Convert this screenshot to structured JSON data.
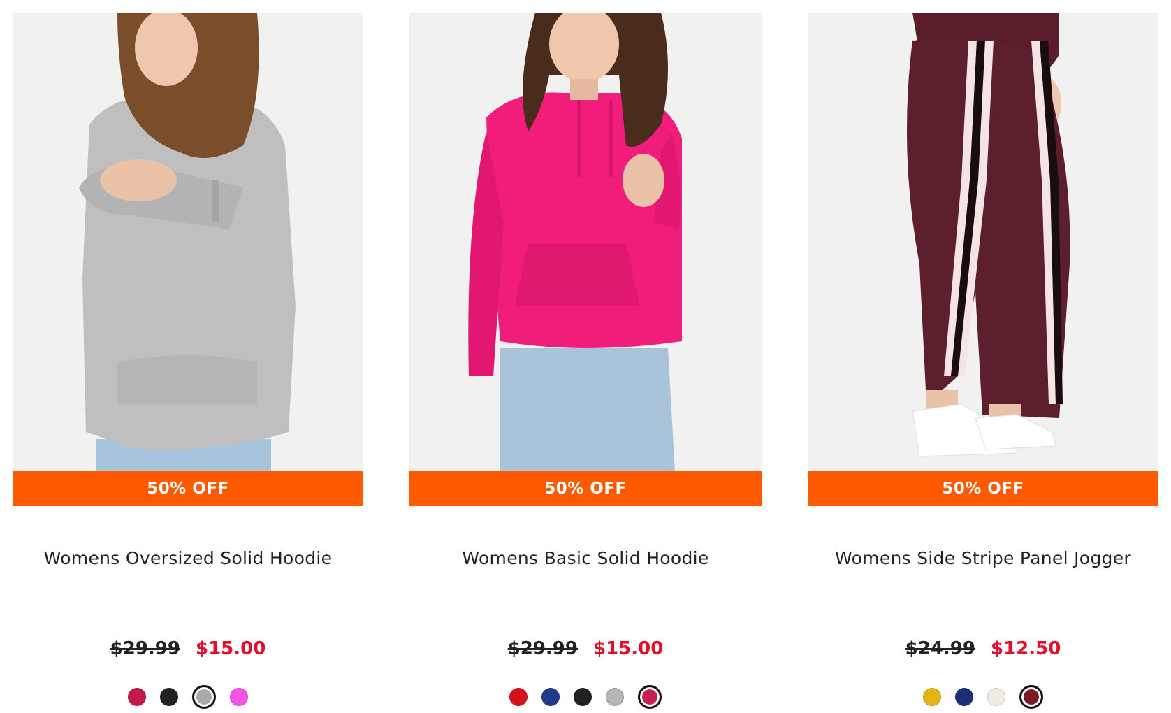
{
  "products": [
    {
      "title": "Womens Oversized Solid Hoodie",
      "badge": "50% OFF",
      "original_price": "$29.99",
      "sale_price": "$15.00",
      "swatches": [
        {
          "name": "berry",
          "color": "#c21a4a",
          "selected": false
        },
        {
          "name": "black",
          "color": "#222222",
          "selected": false
        },
        {
          "name": "heather-grey",
          "color": "#a8a9ab",
          "selected": true
        },
        {
          "name": "pink",
          "color": "#f553e8",
          "selected": false
        }
      ]
    },
    {
      "title": "Womens Basic Solid Hoodie",
      "badge": "50% OFF",
      "original_price": "$29.99",
      "sale_price": "$15.00",
      "swatches": [
        {
          "name": "red",
          "color": "#d8101c",
          "selected": false
        },
        {
          "name": "navy",
          "color": "#223a8c",
          "selected": false
        },
        {
          "name": "black",
          "color": "#222222",
          "selected": false
        },
        {
          "name": "grey",
          "color": "#b5b6b8",
          "selected": false
        },
        {
          "name": "fuchsia",
          "color": "#c8204e",
          "selected": true
        }
      ]
    },
    {
      "title": "Womens Side Stripe Panel Jogger",
      "badge": "50% OFF",
      "original_price": "$24.99",
      "sale_price": "$12.50",
      "swatches": [
        {
          "name": "mustard",
          "color": "#e2b514",
          "selected": false
        },
        {
          "name": "navy",
          "color": "#1c2f78",
          "selected": false
        },
        {
          "name": "cream",
          "color": "#f1ebe4",
          "selected": false
        },
        {
          "name": "burgundy",
          "color": "#7a1a26",
          "selected": true
        }
      ]
    }
  ],
  "colors": {
    "badge_background": "#ff5a00",
    "sale_price": "#e0102a",
    "photo_background": "#f1f1f0"
  }
}
